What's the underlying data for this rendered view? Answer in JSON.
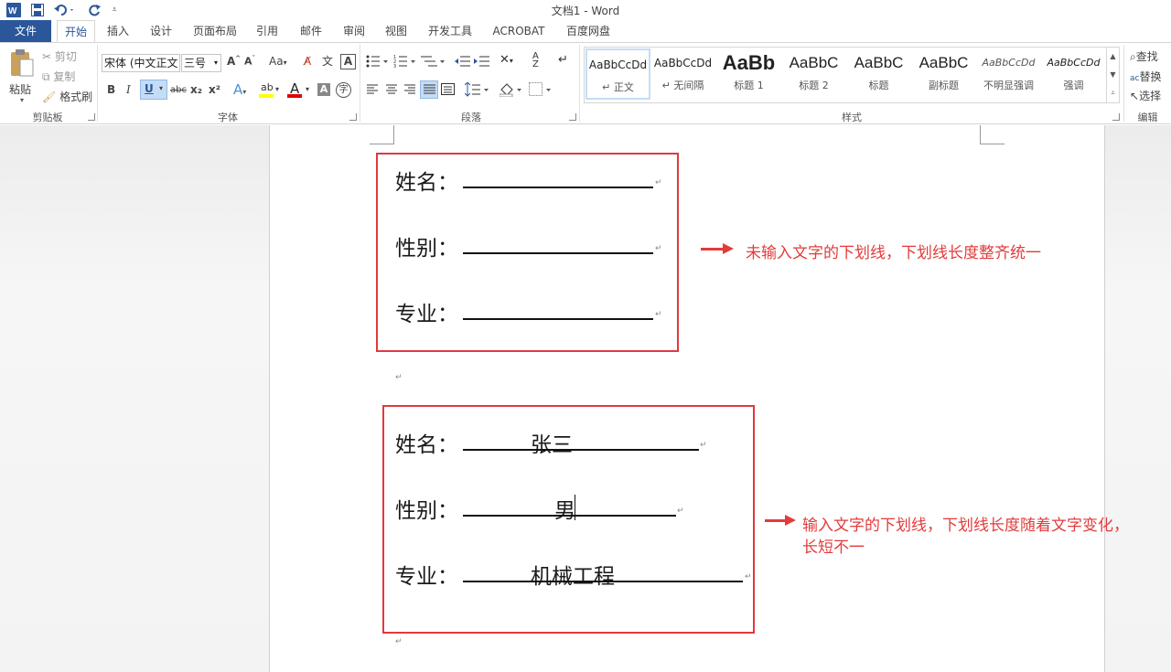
{
  "window": {
    "title": "文档1 - Word"
  },
  "tabs": [
    "文件",
    "开始",
    "插入",
    "设计",
    "页面布局",
    "引用",
    "邮件",
    "审阅",
    "视图",
    "开发工具",
    "ACROBAT",
    "百度网盘"
  ],
  "clipboard": {
    "paste": "粘贴",
    "cut": "剪切",
    "copy": "复制",
    "format_painter": "格式刷",
    "group": "剪贴板"
  },
  "font": {
    "name": "宋体 (中文正文",
    "size": "三号",
    "group": "字体",
    "bold": "B",
    "italic": "I",
    "underline": "U",
    "strike": "abc",
    "sub": "x₂",
    "sup": "x²",
    "clear": "Aa"
  },
  "paragraph": {
    "group": "段落"
  },
  "styles": {
    "group": "样式",
    "items": [
      {
        "preview": "AaBbCcDd",
        "name": "↵ 正文"
      },
      {
        "preview": "AaBbCcDd",
        "name": "↵ 无间隔"
      },
      {
        "preview": "AaBb",
        "name": "标题 1"
      },
      {
        "preview": "AaBbC",
        "name": "标题 2"
      },
      {
        "preview": "AaBbC",
        "name": "标题"
      },
      {
        "preview": "AaBbC",
        "name": "副标题"
      },
      {
        "preview": "AaBbCcDd",
        "name": "不明显强调"
      },
      {
        "preview": "AaBbCcDd",
        "name": "强调"
      }
    ]
  },
  "editing": {
    "find": "查找",
    "replace": "替换",
    "select": "选择",
    "group": "编辑"
  },
  "document": {
    "box1": {
      "fields": [
        {
          "label": "姓名：",
          "value": ""
        },
        {
          "label": "性别：",
          "value": ""
        },
        {
          "label": "专业：",
          "value": ""
        }
      ],
      "note": "未输入文字的下划线，下划线长度整齐统一"
    },
    "box2": {
      "fields": [
        {
          "label": "姓名：",
          "value": "张三"
        },
        {
          "label": "性别：",
          "value": "男"
        },
        {
          "label": "专业：",
          "value": "机械工程"
        }
      ],
      "note_line1": "输入文字的下划线，下划线长度随着文字变化，",
      "note_line2": "长短不一"
    },
    "para_mark": "↵"
  },
  "colors": {
    "accent": "#2b579a",
    "annotation": "#e33b3b",
    "highlight_yellow": "#ffff00",
    "font_red": "#e00000"
  }
}
